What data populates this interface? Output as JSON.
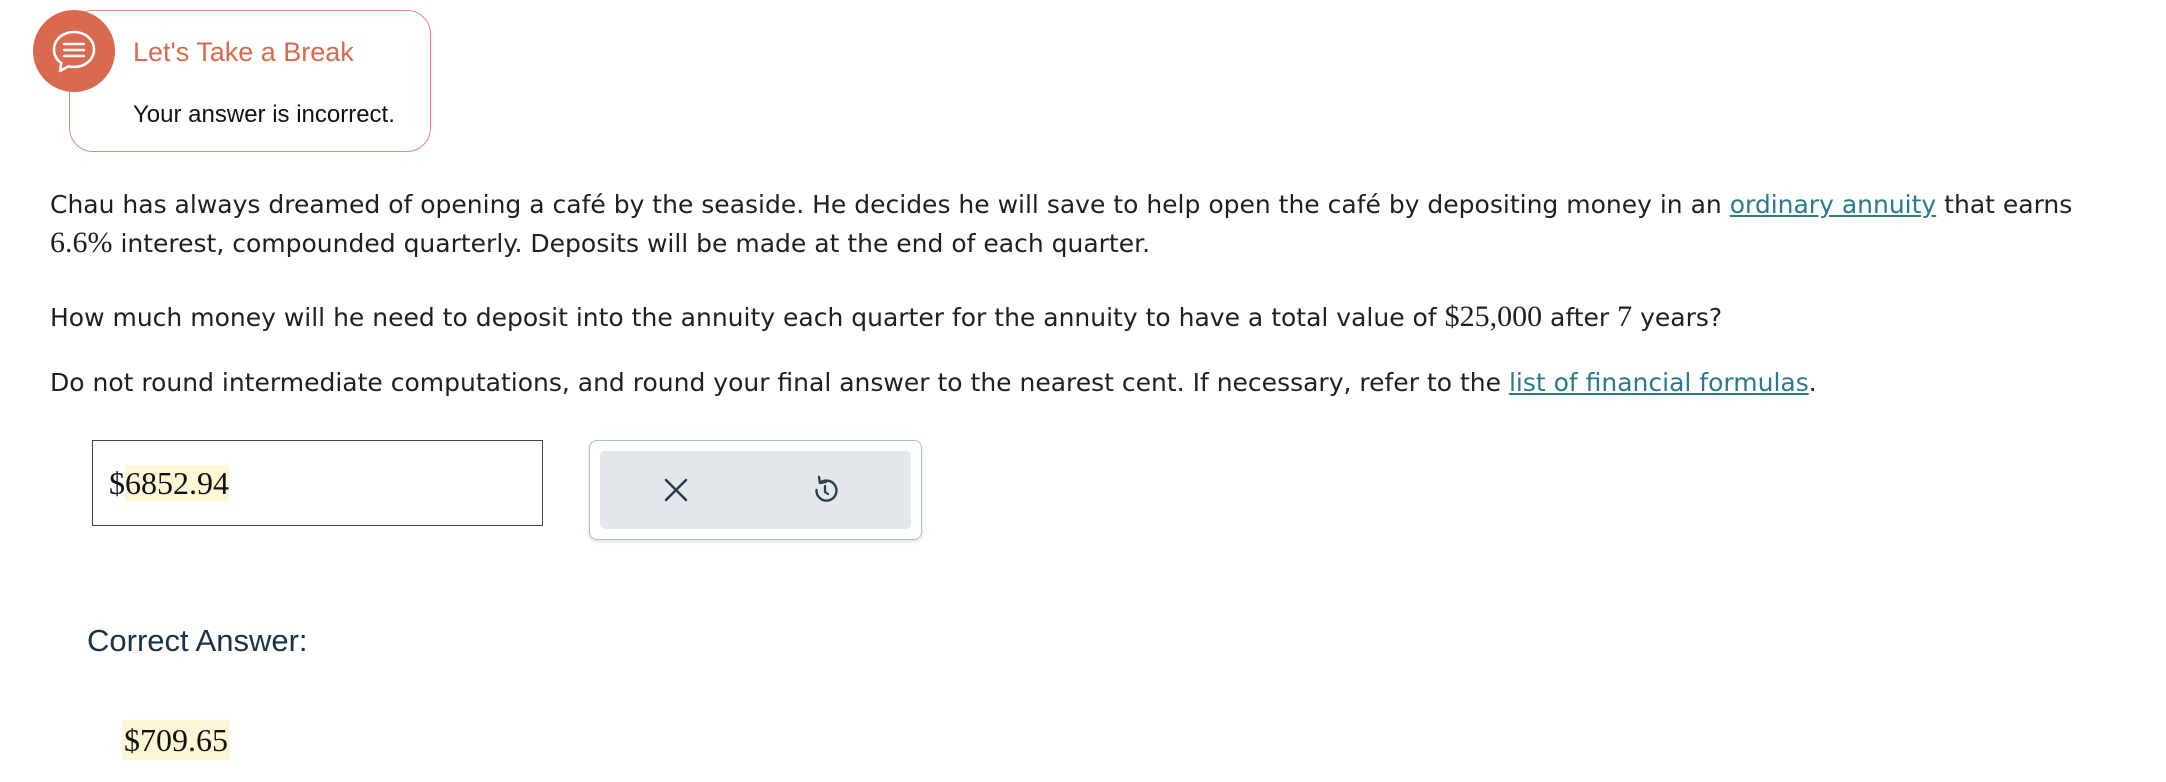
{
  "feedback": {
    "icon": "chat-bubble-icon",
    "title": "Let's Take a Break",
    "message": "Your answer is incorrect.",
    "accent_color": "#d9694f"
  },
  "problem": {
    "p1_before_link": "Chau has always dreamed of opening a café by the seaside. He decides he will save to help open the café by depositing money in an ",
    "p1_link": "ordinary annuity",
    "p1_after_link": " that earns ",
    "rate": "6.6%",
    "p1_end": " interest, compounded quarterly. Deposits will be made at the end of each quarter.",
    "p2_before": "How much money will he need to deposit into the annuity each quarter for the annuity to have a total value of ",
    "target_value": "$25,000",
    "p2_mid": " after ",
    "years": "7",
    "p2_end": " years?",
    "p3_before_link": "Do not round intermediate computations, and round your final answer to the nearest cent. If necessary, refer to the ",
    "p3_link": "list of financial formulas",
    "p3_end": ".",
    "link_color": "#2b7a8c"
  },
  "answer": {
    "currency": "$",
    "value": "6852.94"
  },
  "buttons": {
    "clear_icon": "close-icon",
    "undo_icon": "undo-icon"
  },
  "correct": {
    "label": "Correct Answer:",
    "value": "$709.65"
  }
}
